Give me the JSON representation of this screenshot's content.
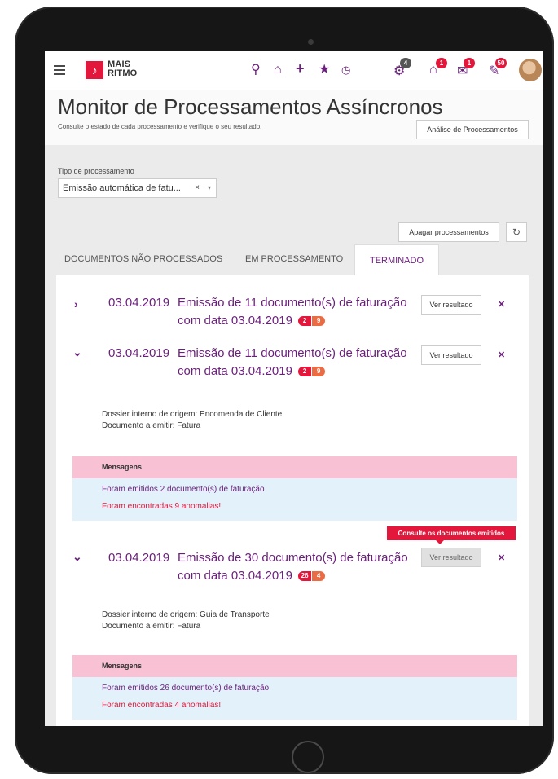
{
  "app": {
    "logo_line1": "MAIS",
    "logo_line2": "RITMO",
    "badges": {
      "settings": "4",
      "box": "1",
      "mail": "1",
      "chat": "50"
    }
  },
  "header": {
    "title": "Monitor de Processamentos Assíncronos",
    "subtitle": "Consulte o estado de cada processamento e verifique o seu resultado.",
    "analise_label": "Análise de Processamentos"
  },
  "filter": {
    "label": "Tipo de processamento",
    "value": "Emissão automática de fatu...",
    "clear": "×",
    "caret": "▾"
  },
  "actions": {
    "apagar_label": "Apagar processamentos"
  },
  "tabs": [
    {
      "label": "DOCUMENTOS NÃO PROCESSADOS"
    },
    {
      "label": "EM PROCESSAMENTO"
    },
    {
      "label": "TERMINADO"
    }
  ],
  "process_items": [
    {
      "date": "03.04.2019",
      "title": "Emissão de 11 documento(s) de faturação com data 03.04.2019",
      "count_ok": "2",
      "count_err": "9",
      "ver_label": "Ver resultado"
    },
    {
      "date": "03.04.2019",
      "title": "Emissão de 11 documento(s) de faturação com data 03.04.2019",
      "count_ok": "2",
      "count_err": "9",
      "ver_label": "Ver resultado",
      "origin": "Dossier interno de origem: Encomenda de Cliente",
      "doc": "Documento a emitir: Fatura",
      "msg_head": "Mensagens",
      "msg_ok": "Foram emitidos 2 documento(s) de faturação",
      "msg_warn": "Foram encontradas 9 anomalias!"
    },
    {
      "date": "03.04.2019",
      "title": "Emissão de 30 documento(s) de faturação com data 03.04.2019",
      "count_ok": "26",
      "count_err": "4",
      "ver_label": "Ver resultado",
      "tooltip": "Consulte os documentos emitidos",
      "origin": "Dossier interno de origem: Guia de Transporte",
      "doc": "Documento a emitir: Fatura",
      "msg_head": "Mensagens",
      "msg_ok": "Foram emitidos 26 documento(s) de faturação",
      "msg_warn": "Foram encontradas 4 anomalias!"
    }
  ],
  "colors": {
    "accent": "#6b1f7c",
    "brand": "#e2173b",
    "message_header": "#f8c2d4",
    "message_body": "#e3f2fa"
  }
}
